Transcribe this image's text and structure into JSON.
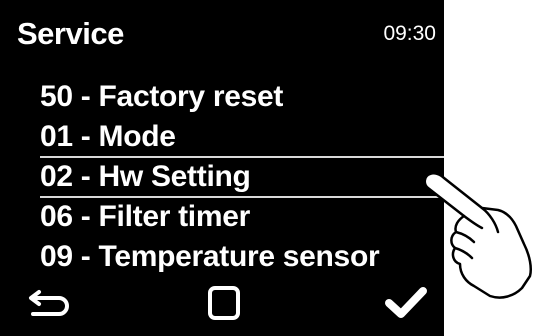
{
  "header": {
    "title": "Service",
    "time": "09:30"
  },
  "menu": {
    "items": [
      {
        "label": "50 - Factory reset",
        "selected": false
      },
      {
        "label": "01 - Mode",
        "selected": false
      },
      {
        "label": "02 - Hw Setting",
        "selected": true
      },
      {
        "label": "06 - Filter timer",
        "selected": false
      },
      {
        "label": "09 - Temperature sensor",
        "selected": false
      }
    ]
  },
  "softkeys": {
    "back_icon": "back-arrow-icon",
    "home_icon": "square-icon",
    "ok_icon": "checkmark-icon"
  },
  "colors": {
    "screen_background": "#000000",
    "text": "#ffffff",
    "selection_line": "#d8d8d8"
  }
}
